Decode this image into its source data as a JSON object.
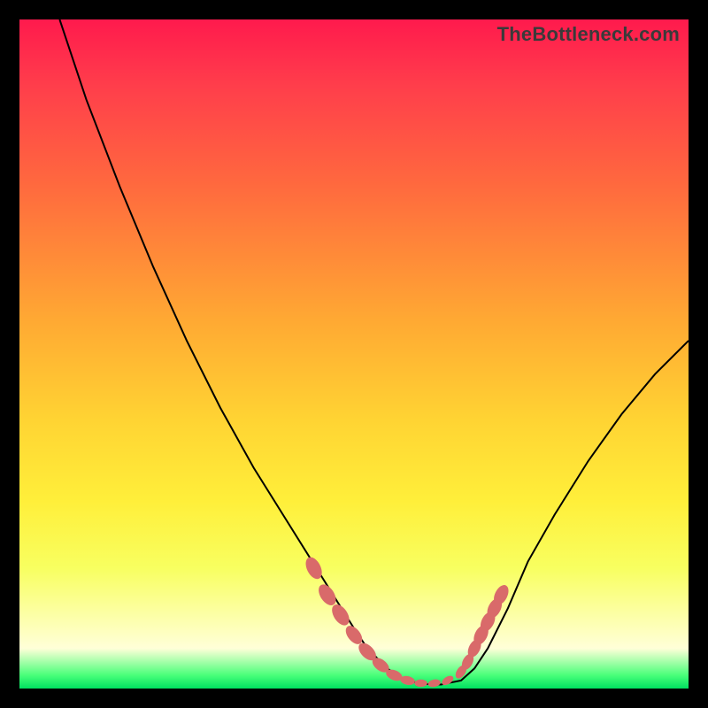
{
  "watermark": "TheBottleneck.com",
  "chart_data": {
    "type": "line",
    "title": "",
    "xlabel": "",
    "ylabel": "",
    "xlim": [
      0,
      100
    ],
    "ylim": [
      0,
      100
    ],
    "series": [
      {
        "name": "bottleneck-curve",
        "x": [
          6,
          10,
          15,
          20,
          25,
          30,
          35,
          40,
          45,
          50,
          52,
          55,
          57,
          60,
          63,
          66,
          68,
          70,
          73,
          76,
          80,
          85,
          90,
          95,
          100
        ],
        "y": [
          100,
          88,
          75,
          63,
          52,
          42,
          33,
          25,
          17,
          9,
          6,
          3,
          1.5,
          0.7,
          0.6,
          1.2,
          3,
          6,
          12,
          19,
          26,
          34,
          41,
          47,
          52
        ]
      }
    ],
    "markers": {
      "name": "highlight-points",
      "x": [
        44,
        46,
        48,
        50,
        52,
        54,
        56,
        58,
        60,
        62,
        64,
        66,
        67,
        68,
        69,
        70,
        71,
        72
      ],
      "y": [
        18,
        14,
        11,
        8,
        5.5,
        3.5,
        2,
        1.2,
        0.8,
        0.8,
        1.2,
        2.5,
        4,
        6,
        8,
        10,
        12,
        14
      ],
      "sizes": [
        11,
        11,
        11,
        10,
        10,
        9,
        8,
        7,
        6,
        6,
        6,
        7,
        8,
        9,
        10,
        10,
        10,
        10
      ]
    },
    "gradient_stops": [
      {
        "pos": 0.0,
        "color": "#ff1a4d"
      },
      {
        "pos": 0.25,
        "color": "#ff6a3e"
      },
      {
        "pos": 0.6,
        "color": "#ffd433"
      },
      {
        "pos": 0.88,
        "color": "#fdffb0"
      },
      {
        "pos": 1.0,
        "color": "#00e060"
      }
    ]
  }
}
